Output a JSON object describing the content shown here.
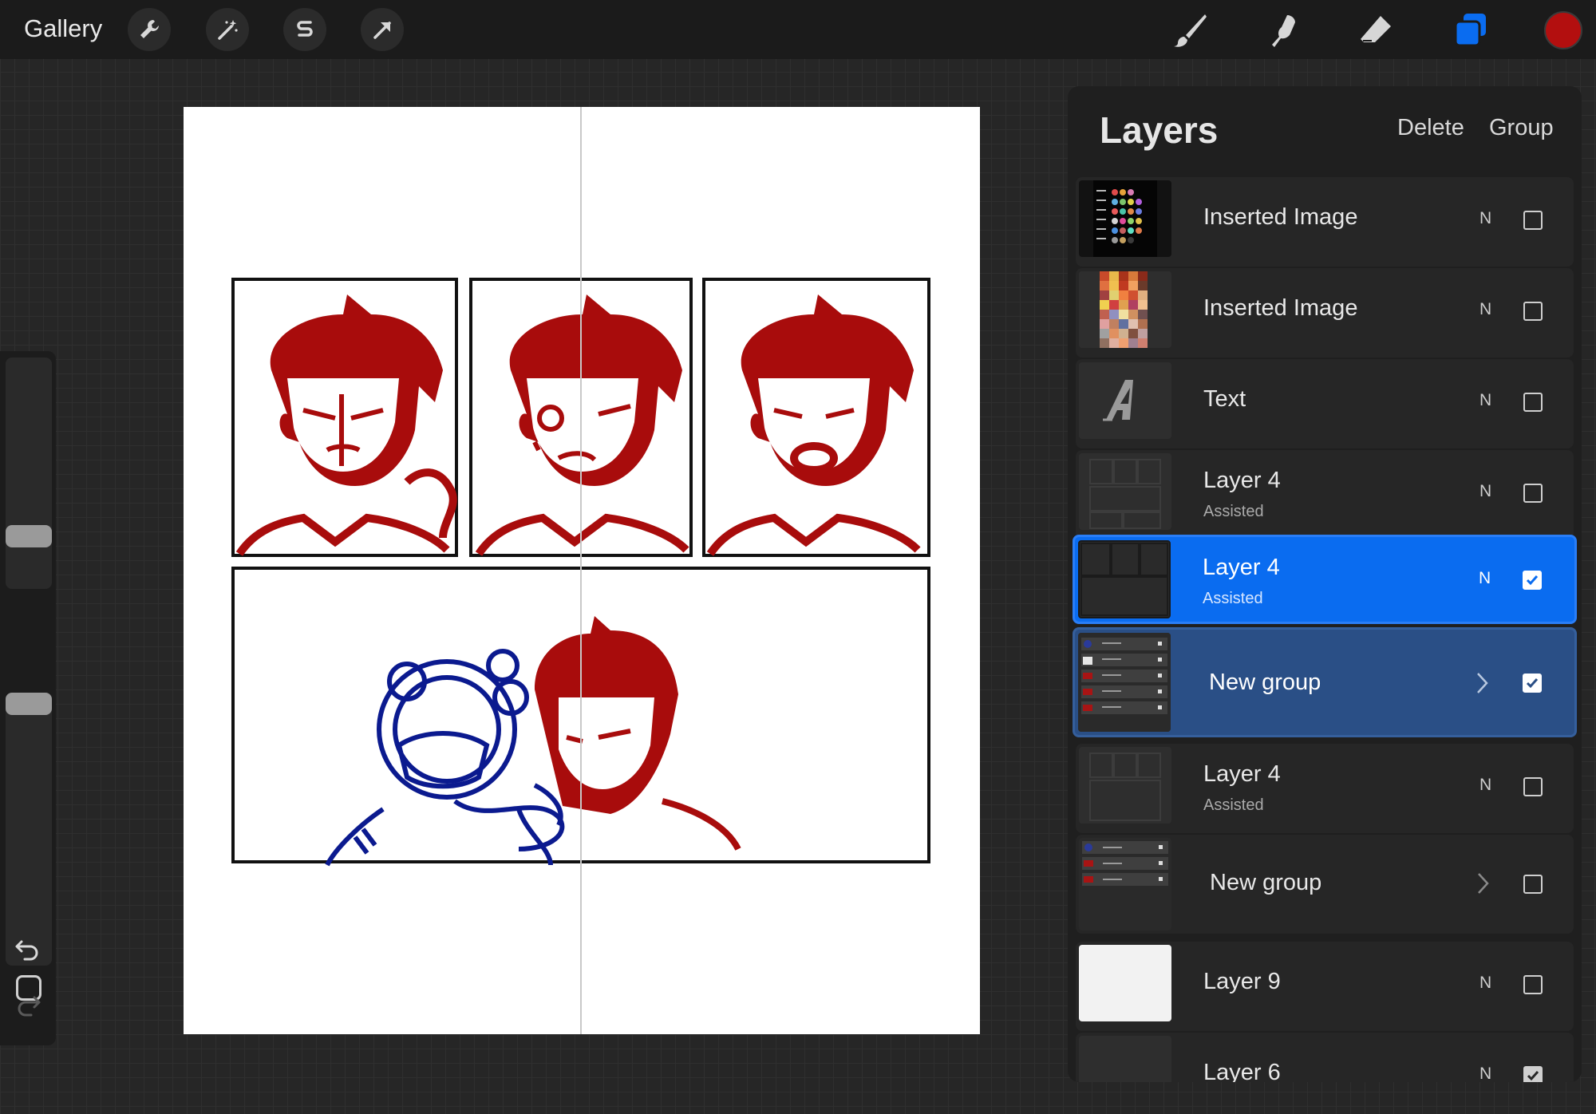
{
  "app": {
    "gallery_label": "Gallery",
    "accent_color": "#0a6cf0",
    "current_color": "#b30f0f"
  },
  "toolbar": {
    "left_tools": [
      "wrench-icon",
      "magic-wand-icon",
      "selection-s-icon",
      "transform-arrow-icon"
    ],
    "right_tools": [
      "brush-icon",
      "smudge-icon",
      "eraser-icon",
      "layers-icon"
    ]
  },
  "layers_panel": {
    "title": "Layers",
    "delete_label": "Delete",
    "group_label": "Group",
    "layers": [
      {
        "name": "Inserted Image",
        "sub": "",
        "blend": "N",
        "visible": false,
        "type": "image"
      },
      {
        "name": "Inserted Image",
        "sub": "",
        "blend": "N",
        "visible": false,
        "type": "image"
      },
      {
        "name": "Text",
        "sub": "",
        "blend": "N",
        "visible": false,
        "type": "text"
      },
      {
        "name": "Layer 4",
        "sub": "Assisted",
        "blend": "N",
        "visible": false,
        "type": "layer"
      },
      {
        "name": "Layer 4",
        "sub": "Assisted",
        "blend": "N",
        "visible": true,
        "type": "layer",
        "selected": true
      },
      {
        "name": "New group",
        "sub": "",
        "blend": "",
        "visible": true,
        "type": "group",
        "group_selected": true
      },
      {
        "name": "Layer 4",
        "sub": "Assisted",
        "blend": "N",
        "visible": false,
        "type": "layer"
      },
      {
        "name": "New group",
        "sub": "",
        "blend": "",
        "visible": false,
        "type": "group"
      },
      {
        "name": "Layer 9",
        "sub": "",
        "blend": "N",
        "visible": false,
        "type": "layer"
      },
      {
        "name": "Layer 6",
        "sub": "",
        "blend": "N",
        "visible": true,
        "type": "layer"
      }
    ]
  }
}
